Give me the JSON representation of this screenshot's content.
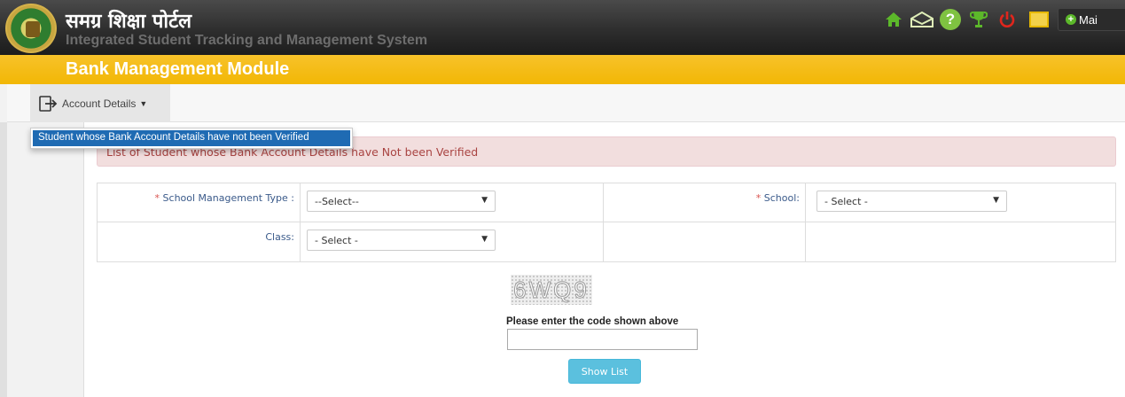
{
  "header": {
    "title_hindi": "समग्र शिक्षा पोर्टल",
    "subtitle": "Integrated Student Tracking and Management System",
    "icons": [
      "home-icon",
      "mail-icon",
      "help-icon",
      "trophy-icon",
      "power-icon",
      "id-card-icon"
    ],
    "main_button_label": "Mai"
  },
  "module": {
    "title": "Bank Management Module"
  },
  "menu": {
    "account_details_label": "Account Details",
    "dropdown_items": [
      "Student whose Bank Account Details have not been Verified"
    ]
  },
  "alert": {
    "text": "List of Student whose Bank Account Details have Not been Verified"
  },
  "form": {
    "required_mark": "*",
    "school_management_type": {
      "label": "School Management Type :",
      "value": "--Select--"
    },
    "school": {
      "label": "School:",
      "value": "- Select -"
    },
    "class": {
      "label": "Class:",
      "value": "- Select -"
    }
  },
  "captcha": {
    "code": "6WQ9",
    "prompt": "Please enter the code shown above",
    "input_value": ""
  },
  "buttons": {
    "show_list": "Show List"
  },
  "colors": {
    "header_bg": "#2e2e2e",
    "module_bar": "#f2b705",
    "dropdown_highlight": "#1f6bb3",
    "alert_bg": "#f2dede",
    "alert_text": "#a94442",
    "button_info": "#5bc0de"
  }
}
